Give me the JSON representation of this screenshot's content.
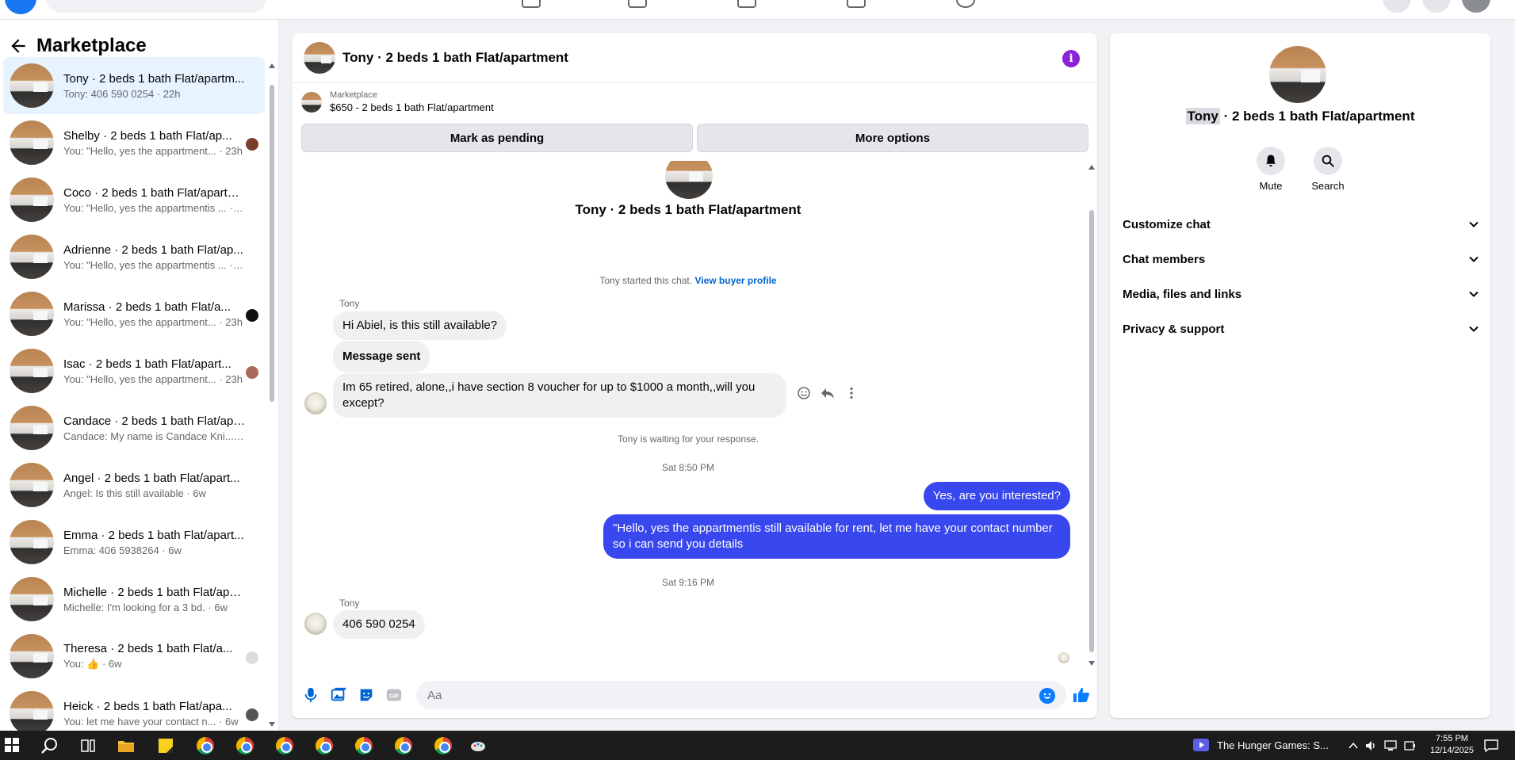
{
  "sidebar": {
    "title": "Marketplace",
    "conversations": [
      {
        "name": "Tony · 2 beds 1 bath Flat/apartm...",
        "preview": "Tony: 406 590 0254 · 22h",
        "active": true,
        "mini": ""
      },
      {
        "name": "Shelby · 2 beds 1 bath Flat/ap...",
        "preview": "You: \"Hello, yes the appartment... · 23h",
        "active": false,
        "mini": "#7a3e2c"
      },
      {
        "name": "Coco · 2 beds 1 bath Flat/apartm...",
        "preview": "You: \"Hello, yes the appartmentis ... · 23h",
        "active": false,
        "mini": ""
      },
      {
        "name": "Adrienne · 2 beds 1 bath Flat/ap...",
        "preview": "You: \"Hello, yes the appartmentis ... · 23h",
        "active": false,
        "mini": ""
      },
      {
        "name": "Marissa · 2 beds 1 bath Flat/a...",
        "preview": "You: \"Hello, yes the appartment... · 23h",
        "active": false,
        "mini": "#111111"
      },
      {
        "name": "Isac · 2 beds 1 bath Flat/apart...",
        "preview": "You: \"Hello, yes the appartment... · 23h",
        "active": false,
        "mini": "#a86a5a"
      },
      {
        "name": "Candace · 2 beds 1 bath Flat/apa...",
        "preview": "Candace: My name is Candace Kni... · 6w",
        "active": false,
        "mini": ""
      },
      {
        "name": "Angel · 2 beds 1 bath Flat/apart...",
        "preview": "Angel: Is this still available · 6w",
        "active": false,
        "mini": ""
      },
      {
        "name": "Emma · 2 beds 1 bath Flat/apart...",
        "preview": "Emma: 406 5938264 · 6w",
        "active": false,
        "mini": ""
      },
      {
        "name": "Michelle · 2 beds 1 bath Flat/apa...",
        "preview": "Michelle: I'm looking for a 3 bd. · 6w",
        "active": false,
        "mini": ""
      },
      {
        "name": "Theresa · 2 beds 1 bath Flat/a...",
        "preview": "You: 👍 · 6w",
        "active": false,
        "mini": "#dcdcdc"
      },
      {
        "name": "Heick · 2 beds 1 bath Flat/apa...",
        "preview": "You: let me have your contact n... · 6w",
        "active": false,
        "mini": "#555555"
      }
    ]
  },
  "chat": {
    "title": "Tony · 2 beds 1 bath Flat/apartment",
    "listing_source": "Marketplace",
    "listing_price": "$650 - 2 beds 1 bath Flat/apartment",
    "btn_pending": "Mark as pending",
    "btn_more": "More options",
    "center_title": "Tony · 2 beds 1 bath Flat/apartment",
    "started_text": "Tony started this chat.",
    "view_profile": "View buyer profile",
    "sender1": "Tony",
    "msg1": "Hi Abiel, is this still available?",
    "msg2": "Message sent",
    "msg3": "Im 65 retired, alone,,i have section 8 voucher for up to $1000 a month,,will you except?",
    "waiting": "Tony is waiting for your response.",
    "time1": "Sat 8:50 PM",
    "out1": "Yes, are you interested?",
    "out2": "\"Hello, yes the appartmentis still available for rent, let me have your contact number so i can send you details",
    "time2": "Sat 9:16 PM",
    "sender2": "Tony",
    "msg4": "406 590 0254",
    "input_placeholder": "Aa"
  },
  "right": {
    "name_highlight": "Tony",
    "name_rest": " · 2 beds 1 bath Flat/apartment",
    "mute": "Mute",
    "search": "Search",
    "sections": [
      "Customize chat",
      "Chat members",
      "Media, files and links",
      "Privacy & support"
    ]
  },
  "taskbar": {
    "media_title": "The Hunger Games: S...",
    "time": "7:55 PM",
    "date": "12/14/2025"
  },
  "colors": {
    "accent": "#0064d1",
    "outgoing_bubble": "#3847ee",
    "info_icon": "#8a22d8",
    "active_row": "#e7f3ff"
  }
}
